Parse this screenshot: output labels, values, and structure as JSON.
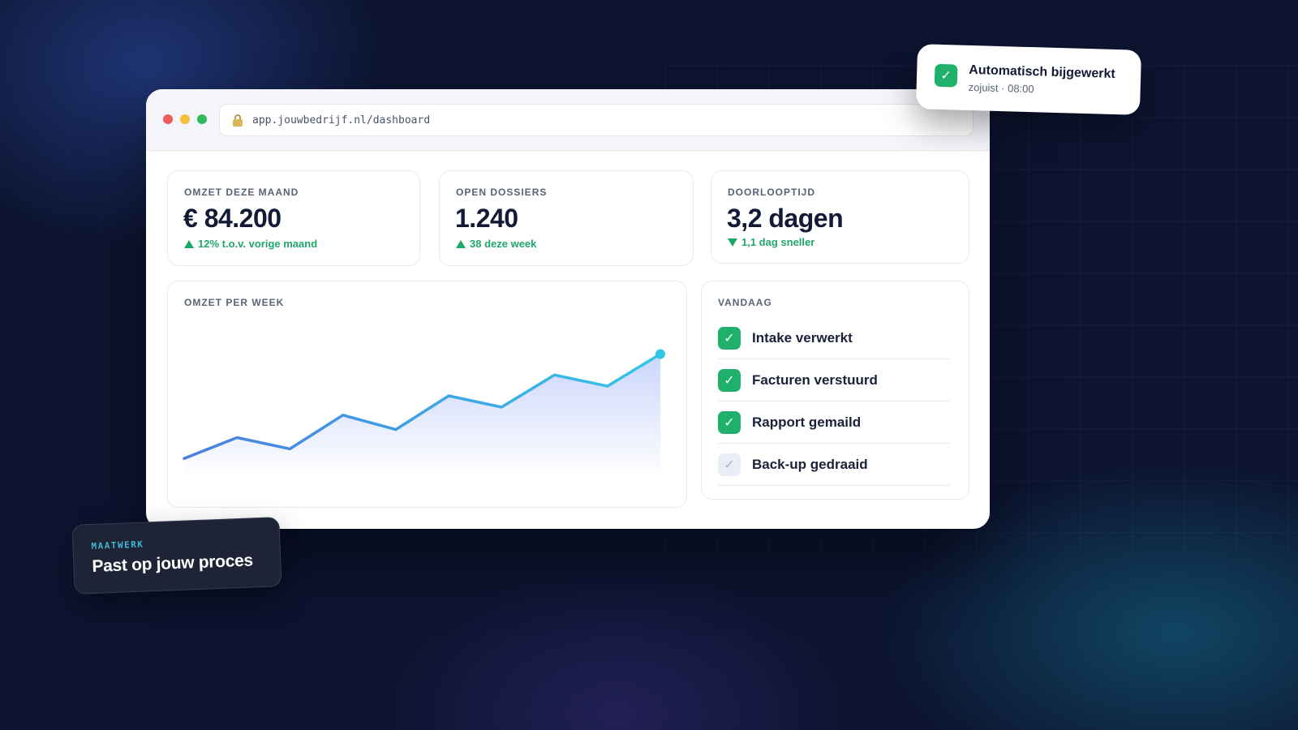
{
  "window": {
    "url": "app.jouwbedrijf.nl/dashboard",
    "traffic_lights": [
      "#ef5b58",
      "#f5bf3b",
      "#2fba5c"
    ]
  },
  "kpis": [
    {
      "label": "OMZET DEZE MAAND",
      "value": "€ 84.200",
      "delta": "12% t.o.v. vorige maand",
      "direction": "up"
    },
    {
      "label": "OPEN DOSSIERS",
      "value": "1.240",
      "delta": "38 deze week",
      "direction": "up"
    },
    {
      "label": "DOORLOOPTIJD",
      "value": "3,2 dagen",
      "delta": "1,1 dag sneller",
      "direction": "down"
    }
  ],
  "chart_panel": {
    "label": "OMZET PER WEEK"
  },
  "chart_data": {
    "type": "area",
    "title": "OMZET PER WEEK",
    "x": [
      1,
      2,
      3,
      4,
      5,
      6,
      7,
      8,
      9,
      10
    ],
    "values": [
      12,
      25,
      18,
      39,
      30,
      51,
      44,
      64,
      57,
      77
    ],
    "ylim": [
      0,
      100
    ],
    "xlabel": "",
    "ylabel": "",
    "grid": false,
    "colors": {
      "line_start": "#4a7fe0",
      "line_end": "#32c6e6",
      "fill": "#c7d3fb"
    }
  },
  "today": {
    "label": "VANDAAG",
    "items": [
      {
        "text": "Intake verwerkt",
        "done": true
      },
      {
        "text": "Facturen verstuurd",
        "done": true
      },
      {
        "text": "Rapport gemaild",
        "done": true
      },
      {
        "text": "Back-up gedraaid",
        "done": false
      }
    ]
  },
  "toast": {
    "title": "Automatisch bijgewerkt",
    "subtitle": "zojuist · 08:00",
    "icon": "check-icon"
  },
  "badge": {
    "kicker": "MAATWERK",
    "title": "Past op jouw proces"
  },
  "colors": {
    "accent_green": "#1fb06c",
    "background": "#0c1430",
    "text_dark": "#121a35"
  }
}
